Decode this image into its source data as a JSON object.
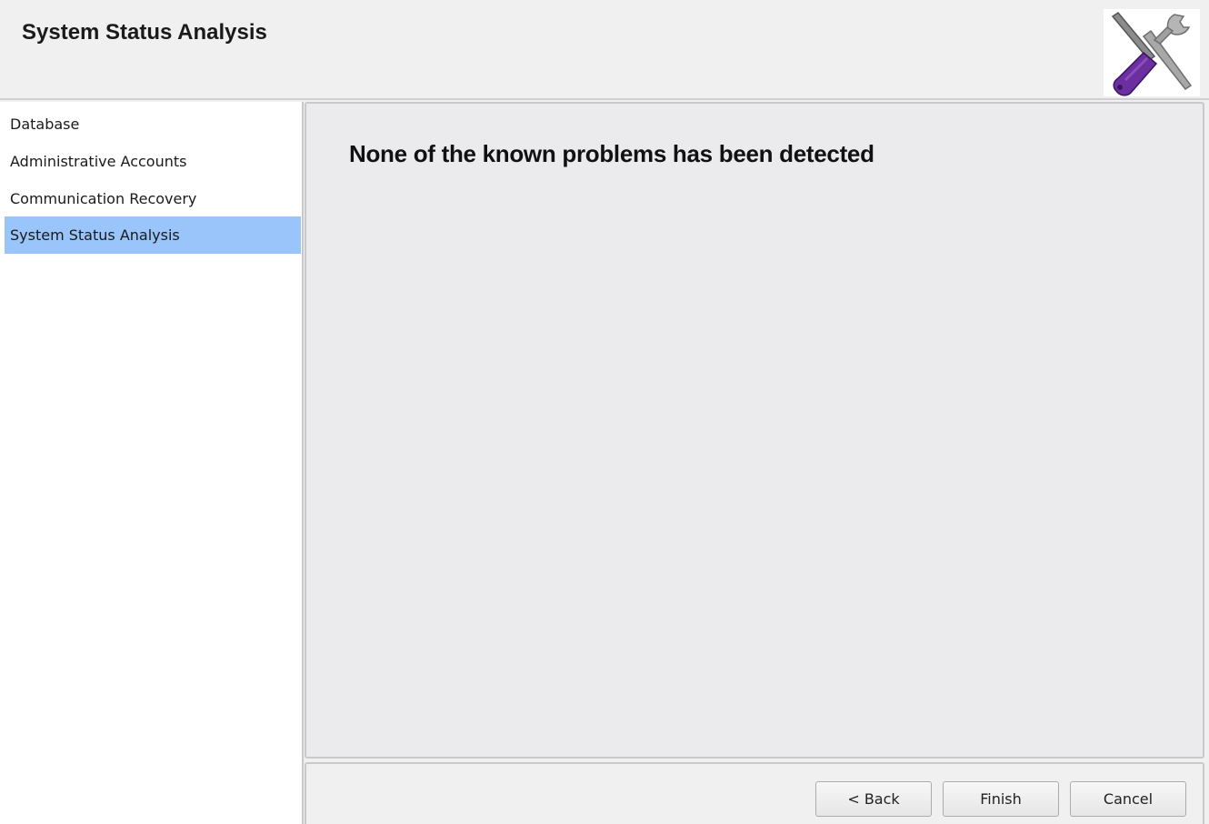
{
  "header": {
    "title": "System Status Analysis",
    "icon": "tools-icon"
  },
  "sidebar": {
    "items": [
      {
        "label": "Database",
        "selected": false
      },
      {
        "label": "Administrative Accounts",
        "selected": false
      },
      {
        "label": "Communication Recovery",
        "selected": false
      },
      {
        "label": "System Status Analysis",
        "selected": true
      }
    ]
  },
  "content": {
    "message": "None of the known problems has been detected"
  },
  "buttons": {
    "back_label": "< Back",
    "finish_label": "Finish",
    "cancel_label": "Cancel"
  },
  "colors": {
    "selected_item": "#99c5fb",
    "screwdriver_handle": "#6b2fa0",
    "wrench": "#9a9a9a"
  }
}
